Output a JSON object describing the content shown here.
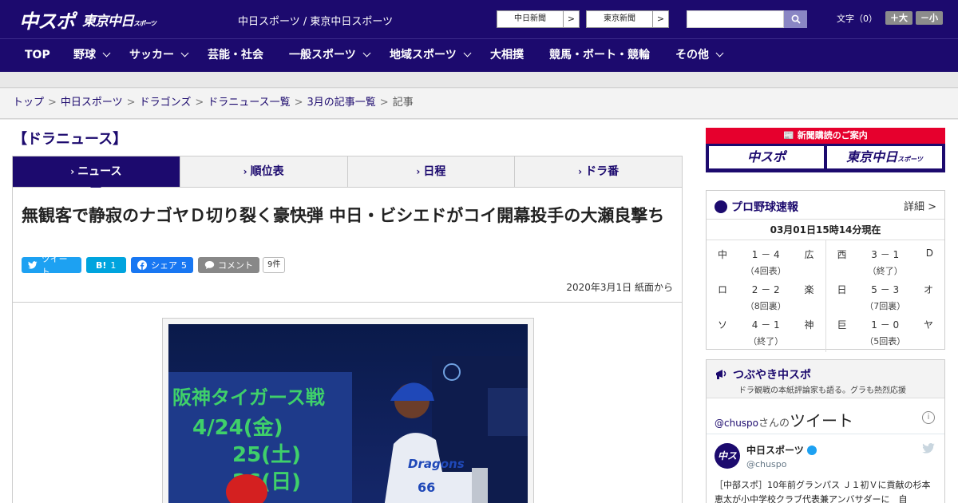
{
  "header": {
    "logo_chuspo": "中スポ",
    "logo_tokyo": "東京中日",
    "logo_tokyo_small": "スポーツ",
    "site_name": "中日スポーツ / 東京中日スポーツ",
    "ext_links": [
      {
        "label": "中日新聞",
        "arrow": ">"
      },
      {
        "label": "東京新聞",
        "arrow": ">"
      }
    ],
    "search_placeholder": "",
    "font_label": "文字（0）",
    "font_bigger": "＋大",
    "font_smaller": "－小"
  },
  "nav": {
    "items": [
      {
        "label": "TOP"
      },
      {
        "label": "野球"
      },
      {
        "label": "サッカー"
      },
      {
        "label": "芸能・社会"
      },
      {
        "label": "一般スポーツ"
      },
      {
        "label": "地域スポーツ"
      },
      {
        "label": "大相撲"
      },
      {
        "label": "競馬・ボート・競輪"
      },
      {
        "label": "その他"
      }
    ]
  },
  "breadcrumb": {
    "items": [
      "トップ",
      "中日スポーツ",
      "ドラゴンズ",
      "ドラニュース一覧",
      "3月の記事一覧"
    ],
    "current": "記事",
    "sep": ">"
  },
  "section_title": "【ドラニュース】",
  "tabs": [
    {
      "label": "ニュース",
      "active": true
    },
    {
      "label": "順位表"
    },
    {
      "label": "日程"
    },
    {
      "label": "ドラ番"
    }
  ],
  "article": {
    "headline": "無観客で静寂のナゴヤＤ切り裂く豪快弾 中日・ビシエドがコイ開幕投手の大瀬良撃ち",
    "share": {
      "tweet": "ツイート",
      "hatena_logo": "B!",
      "hatena_count": "1",
      "fb_label": "シェア",
      "fb_count": "5",
      "comment": "コメント",
      "comment_count": "9件"
    },
    "dateline": "2020年3月1日 紙面から",
    "photo": {
      "board_line1": "阪神タイガース戦",
      "board_line2": "4/24(金)",
      "board_line3": "25(土)",
      "board_line4": "26(日)",
      "jersey_text": "Dragons",
      "jersey_number": "66"
    }
  },
  "subscription": {
    "head": "新聞購読のご案内",
    "logo1": "中スポ",
    "logo2": "東京中日",
    "logo2_small": "スポーツ"
  },
  "scoreboard": {
    "title": "プロ野球速報",
    "more": "詳細 >",
    "time": "03月01日15時14分現在",
    "games_left": [
      {
        "home": "中",
        "score": "1 － 4",
        "away": "広",
        "status": "（4回表）"
      },
      {
        "home": "ロ",
        "score": "2 － 2",
        "away": "楽",
        "status": "（8回裏）"
      },
      {
        "home": "ソ",
        "score": "4 － 1",
        "away": "神",
        "status": "（終了）"
      }
    ],
    "games_right": [
      {
        "home": "西",
        "score": "3 － 1",
        "away": "D",
        "status": "（終了）"
      },
      {
        "home": "日",
        "score": "5 － 3",
        "away": "オ",
        "status": "（7回裏）"
      },
      {
        "home": "巨",
        "score": "1 － 0",
        "away": "ヤ",
        "status": "（5回表）"
      }
    ]
  },
  "tweets": {
    "title": "つぶやき中スポ",
    "subtitle": "ドラ観戦の本紙評論家も語る。グラも熱烈応援",
    "handle": "@chuspo",
    "handle_suffix": "さんの",
    "big": "ツイート",
    "info": "i",
    "avatar_text": "中スポ",
    "name": "中日スポーツ",
    "screen_name": "@chuspo",
    "text": "［中部スポ］10年前グランパス Ｊ１初Ｖに貢献の杉本恵太が小中学校クラブ代表兼アンバサダーに　自"
  },
  "colors": {
    "brand": "#1c0a6e",
    "accent_red": "#e6002d",
    "twitter": "#1da1f2",
    "facebook": "#1877f2"
  }
}
